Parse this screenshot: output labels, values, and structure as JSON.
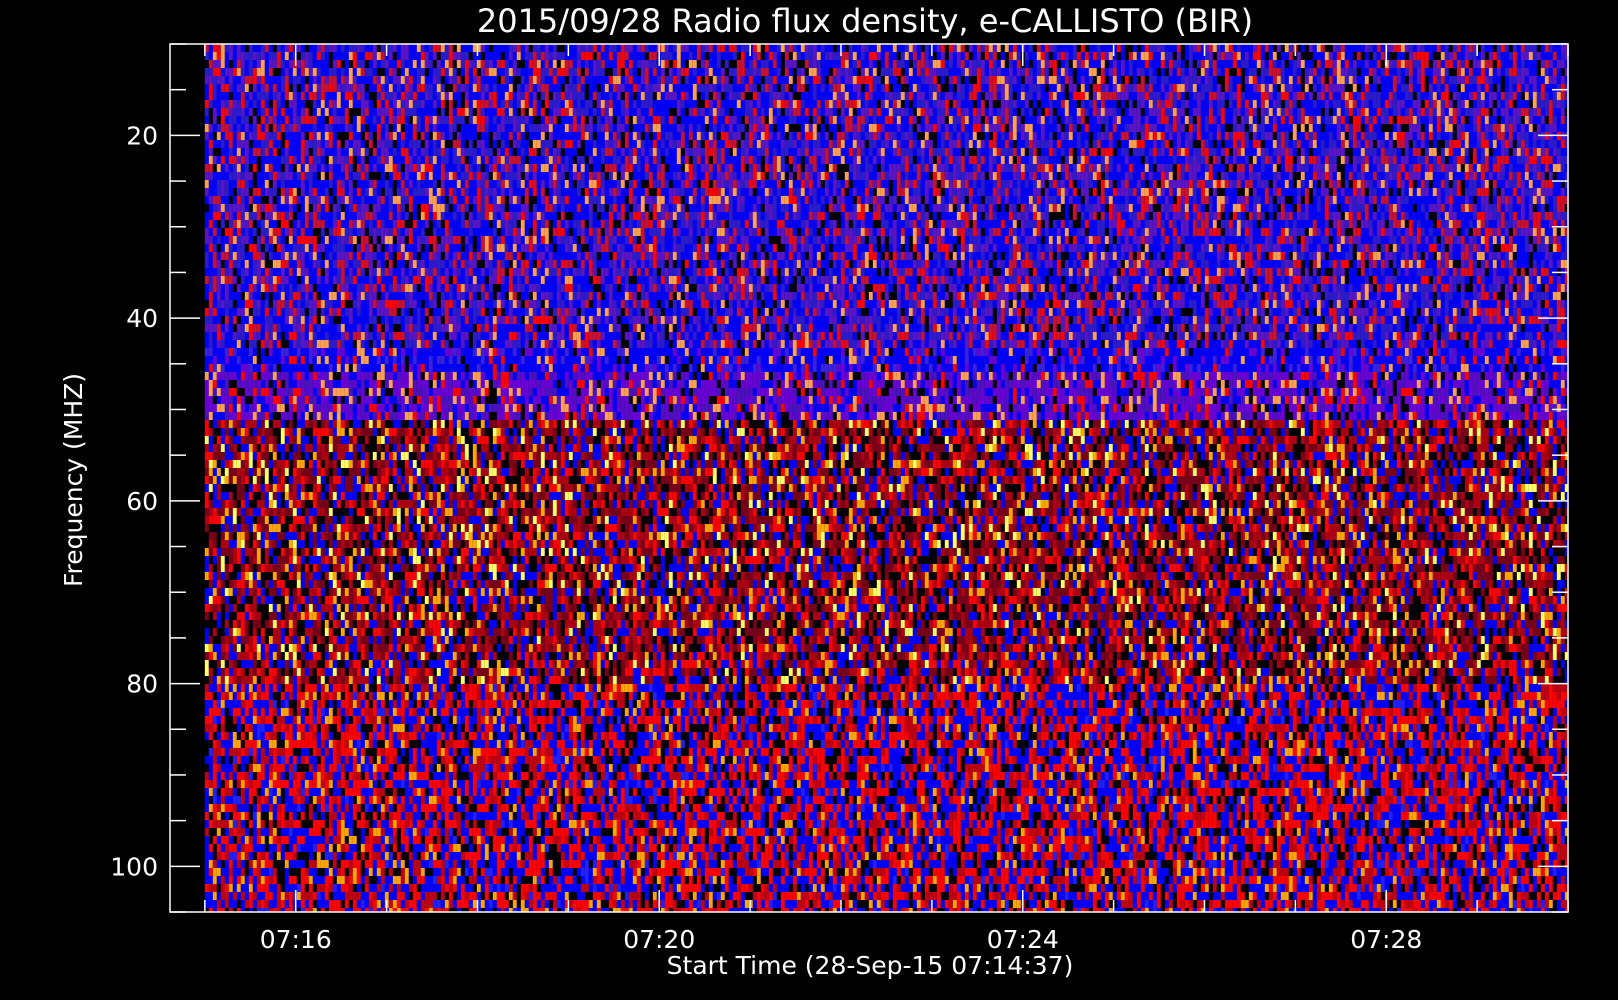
{
  "chart_data": {
    "type": "heatmap",
    "title": "2015/09/28  Radio flux density, e-CALLISTO (BIR)",
    "xlabel": "Start Time (28-Sep-15 07:14:37)",
    "ylabel": "Frequency (MHZ)",
    "x_axis": {
      "range": [
        "07:14:37",
        "07:30:00"
      ],
      "major_ticks": [
        "07:16",
        "07:20",
        "07:24",
        "07:28"
      ],
      "minor_tick_interval_minutes": 1
    },
    "y_axis": {
      "range": [
        105,
        10
      ],
      "inverted": true,
      "major_ticks": [
        20,
        40,
        60,
        80,
        100
      ],
      "minor_tick_interval": 5
    },
    "data_extent": {
      "time": [
        "07:15:00",
        "07:30:00"
      ],
      "frequency_mhz": [
        10,
        105
      ]
    },
    "colormap": [
      "#000000",
      "#0000ff",
      "#6a00d8",
      "#ff0000",
      "#ffa500",
      "#ffff00"
    ],
    "bands": [
      {
        "frequency_mhz": [
          10,
          43
        ],
        "dominant": "blue-purple"
      },
      {
        "frequency_mhz": [
          43,
          46
        ],
        "dominant": "bright blue"
      },
      {
        "frequency_mhz": [
          46,
          51
        ],
        "dominant": "purple"
      },
      {
        "frequency_mhz": [
          51,
          105
        ],
        "dominant": "red-blue mix"
      }
    ],
    "grid": false,
    "legend": "none"
  }
}
